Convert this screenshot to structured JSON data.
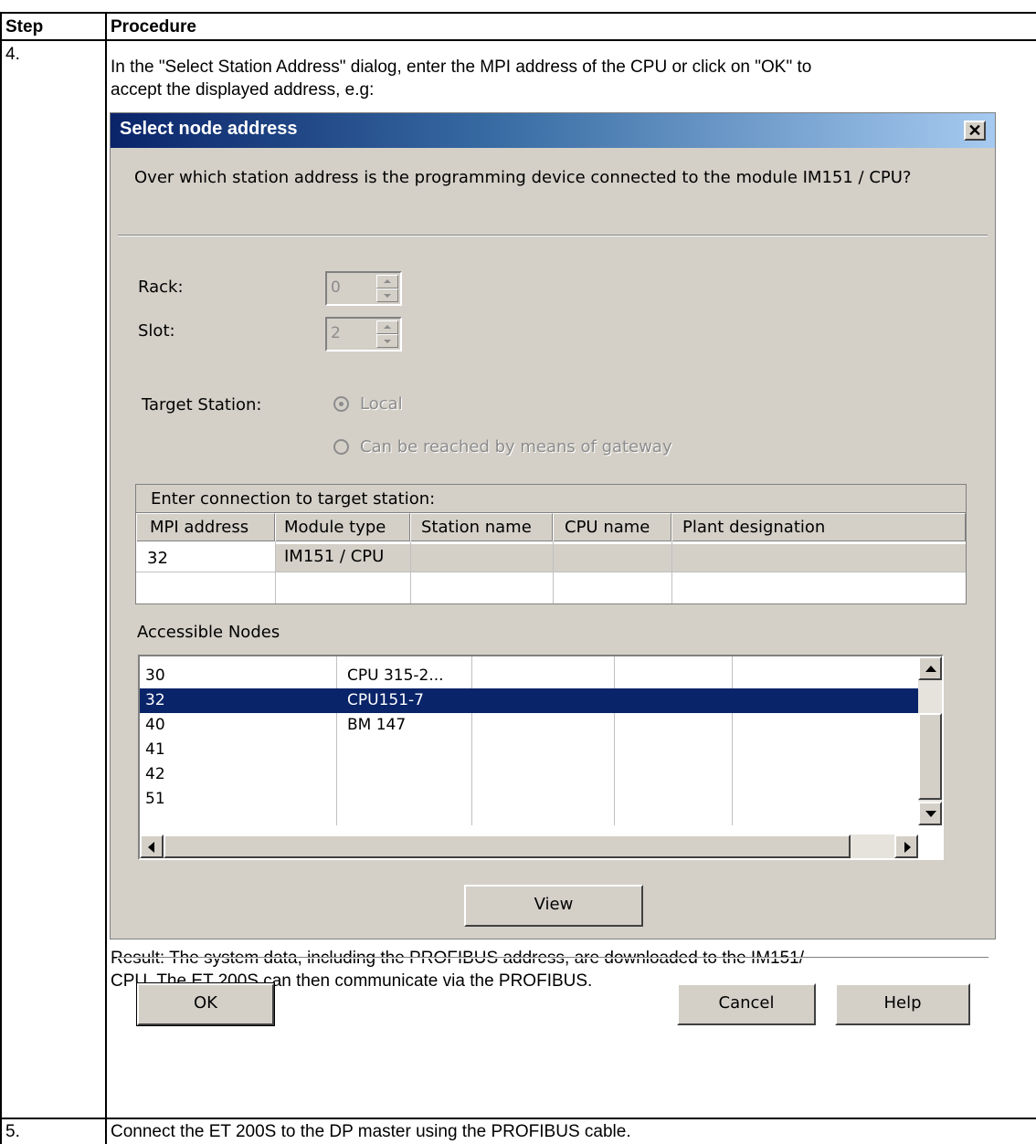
{
  "table": {
    "header": {
      "step": "Step",
      "procedure": "Procedure"
    },
    "row4": {
      "step": "4.",
      "intro_line1": "In the \"Select Station Address\" dialog, enter the MPI address of the CPU or click on \"OK\" to",
      "intro_line2": "accept the displayed address, e.g:",
      "result_line1": "Result: The system data, including the PROFIBUS address, are downloaded to the IM151/",
      "result_line2": "CPU. The ET 200S can then communicate via the PROFIBUS."
    },
    "row5": {
      "step": "5.",
      "text": "Connect the ET 200S to the DP master using the PROFIBUS cable."
    }
  },
  "dialog": {
    "title": "Select node address",
    "close_glyph": "✕",
    "question": "Over which station address is the programming device connected to the module IM151 / CPU?",
    "rack_label": "Rack:",
    "rack_value": "0",
    "slot_label": "Slot:",
    "slot_value": "2",
    "target_label": "Target Station:",
    "target_options": [
      "Local",
      "Can be reached by means of gateway"
    ],
    "target_selected": "Local",
    "connection": {
      "caption": "Enter connection to target station:",
      "columns": [
        "MPI address",
        "Module type",
        "Station name",
        "CPU name",
        "Plant designation"
      ],
      "rows": [
        [
          "32",
          "IM151 / CPU",
          "",
          "",
          ""
        ]
      ]
    },
    "accessible_label": "Accessible Nodes",
    "nodes": [
      {
        "address": "30",
        "module": "CPU 315-2..."
      },
      {
        "address": "32",
        "module": "CPU151-7"
      },
      {
        "address": "40",
        "module": "BM 147"
      },
      {
        "address": "41",
        "module": ""
      },
      {
        "address": "42",
        "module": ""
      },
      {
        "address": "51",
        "module": ""
      }
    ],
    "selected_node_index": 1,
    "view_button": "View",
    "ok_button": "OK",
    "cancel_button": "Cancel",
    "help_button": "Help"
  }
}
